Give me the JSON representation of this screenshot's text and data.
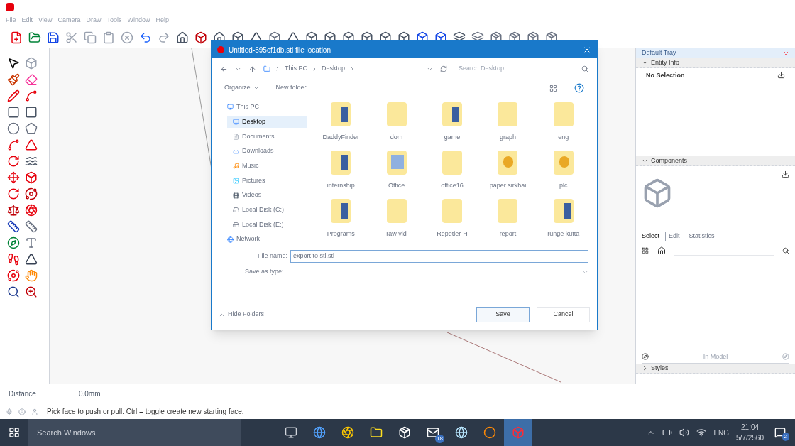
{
  "menu": [
    "File",
    "Edit",
    "View",
    "Camera",
    "Draw",
    "Tools",
    "Window",
    "Help"
  ],
  "dialog": {
    "title": "Untitled-595cf1db.stl file location",
    "path": [
      "This PC",
      "Desktop"
    ],
    "search_placeholder": "Search Desktop",
    "organize": "Organize",
    "new_folder": "New folder",
    "nav": [
      {
        "label": "This PC",
        "kind": "pc",
        "selected": false
      },
      {
        "label": "Desktop",
        "kind": "desktop",
        "selected": true
      },
      {
        "label": "Documents",
        "kind": "docs",
        "selected": false
      },
      {
        "label": "Downloads",
        "kind": "down",
        "selected": false
      },
      {
        "label": "Music",
        "kind": "music",
        "selected": false
      },
      {
        "label": "Pictures",
        "kind": "pics",
        "selected": false
      },
      {
        "label": "Videos",
        "kind": "video",
        "selected": false
      },
      {
        "label": "Local Disk (C:)",
        "kind": "disk",
        "selected": false
      },
      {
        "label": "Local Disk (E:)",
        "kind": "disk",
        "selected": false
      },
      {
        "label": "Network",
        "kind": "net",
        "selected": false
      }
    ],
    "files": [
      {
        "name": "DaddyFinder",
        "kind": "doc"
      },
      {
        "name": "dom",
        "kind": "folder"
      },
      {
        "name": "game",
        "kind": "doc"
      },
      {
        "name": "graph",
        "kind": "folder"
      },
      {
        "name": "eng",
        "kind": "folder"
      },
      {
        "name": "internship",
        "kind": "doc"
      },
      {
        "name": "Office",
        "kind": "pic"
      },
      {
        "name": "office16",
        "kind": "folder"
      },
      {
        "name": "paper sirkhai",
        "kind": "figure"
      },
      {
        "name": "plc",
        "kind": "figure"
      },
      {
        "name": "Programs",
        "kind": "doc"
      },
      {
        "name": "raw vid",
        "kind": "folder"
      },
      {
        "name": "Repetier-H",
        "kind": "folder"
      },
      {
        "name": "report",
        "kind": "folder"
      },
      {
        "name": "runge kutta",
        "kind": "doc"
      }
    ],
    "file_name_label": "File name:",
    "file_name": "export to stl.stl",
    "type_label": "Save as type:",
    "hide_folders": "Hide Folders",
    "buttons": [
      {
        "label": "Save",
        "default": true
      },
      {
        "label": "Cancel",
        "default": false
      }
    ]
  },
  "tray": {
    "title": "Default Tray",
    "panels": [
      {
        "title": "Entity Info",
        "expanded": true,
        "kind": "entity",
        "text": "No Selection"
      },
      {
        "title": "Components",
        "expanded": true,
        "kind": "components",
        "tabs": [
          {
            "label": "Select",
            "selected": true
          },
          {
            "label": "Edit",
            "selected": false
          },
          {
            "label": "Statistics",
            "selected": false
          }
        ],
        "footer": "In Model"
      },
      {
        "title": "Styles",
        "expanded": false,
        "kind": "styles"
      }
    ]
  },
  "measurement": {
    "label": "Distance",
    "value": "0.0mm"
  },
  "hint": "Pick face to push or pull. Ctrl = toggle create new starting face.",
  "taskbar": {
    "search_placeholder": "Search Windows",
    "apps": [
      {
        "kind": "taskview",
        "selected": false
      },
      {
        "kind": "edge",
        "selected": false
      },
      {
        "kind": "chrome",
        "selected": false
      },
      {
        "kind": "explorer",
        "selected": false
      },
      {
        "kind": "store",
        "selected": false
      },
      {
        "kind": "mail",
        "badge": "18",
        "selected": false
      },
      {
        "kind": "globe",
        "selected": false
      },
      {
        "kind": "ring",
        "selected": false
      },
      {
        "kind": "sketchup",
        "selected": true
      }
    ],
    "language": "ENG",
    "time": "21:04",
    "date": "5/7/2560",
    "notifications": "2"
  }
}
